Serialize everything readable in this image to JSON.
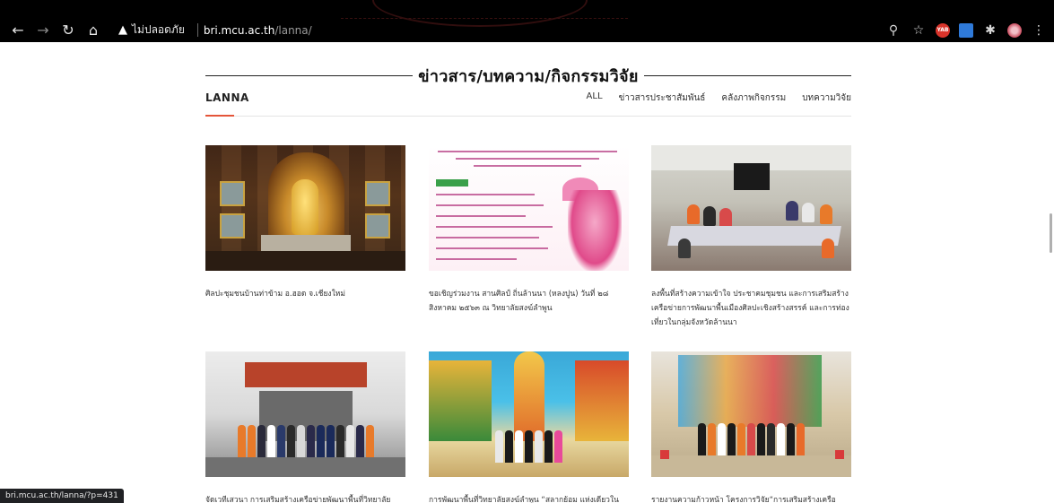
{
  "browser": {
    "security_label": "ไม่ปลอดภัย",
    "url_host": "bri.mcu.ac.th",
    "url_path": "/lanna/",
    "status_url": "bri.mcu.ac.th/lanna/?p=431",
    "ext_badge_label": "YAB"
  },
  "page": {
    "section_title": "ข่าวสาร/บทความ/กิจกรรมวิจัย",
    "brand": "LANNA",
    "filters": [
      "ALL",
      "ข่าวสารประชาสัมพันธ์",
      "คลังภาพกิจกรรม",
      "บทความวิจัย"
    ]
  },
  "posts": [
    {
      "caption": "ศิลปะชุมชนบ้านท่าข้าม อ.ฮอด จ.เชียงใหม่"
    },
    {
      "caption": "ขอเชิญร่วมงาน สานศิลป์ ถิ่นล้านนา (หลงปูน) วันที่ ๒๘ สิงหาคม ๒๕๖๓ ณ วิทยาลัยสงฆ์ลำพูน"
    },
    {
      "caption": "ลงพื้นที่สร้างความเข้าใจ ประชาคมชุมชน และการเสริมสร้างเครือข่ายการพัฒนาพื้นเมืองศิลปะเชิงสร้างสรรค์ และการท่องเที่ยวในกลุ่มจังหวัดล้านนา"
    },
    {
      "caption": "จัดเวทีเสวนา การเสริมสร้างเครือข่ายพัฒนาพื้นที่วิทยาลัย"
    },
    {
      "caption": "การพัฒนาพื้นที่วิทยาลัยสงฆ์ลำพูน “สลากย้อม แห่งเดียวใน"
    },
    {
      "caption": "รายงานความก้าวหน้า โครงการวิจัย“การเสริมสร้างเครือ"
    }
  ]
}
